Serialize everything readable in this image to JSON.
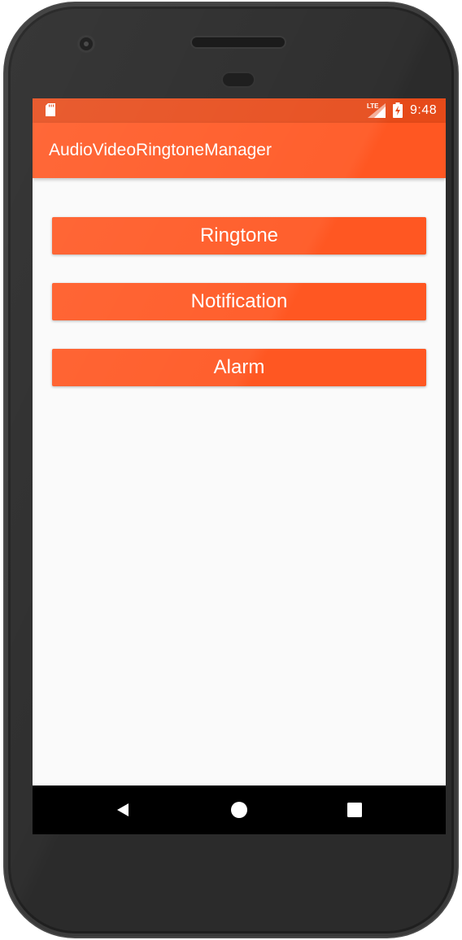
{
  "status_bar": {
    "time": "9:48",
    "network_label": "LTE",
    "icons": [
      "sd-card-icon",
      "signal-icon",
      "battery-charging-icon"
    ]
  },
  "app_bar": {
    "title": "AudioVideoRingtoneManager"
  },
  "buttons": {
    "ringtone": "Ringtone",
    "notification": "Notification",
    "alarm": "Alarm"
  },
  "nav_bar": {
    "icons": [
      "back-icon",
      "home-icon",
      "recents-icon"
    ]
  },
  "colors": {
    "primary": "#ff5722",
    "primary_dark": "#e64a19",
    "background": "#fafafa",
    "nav_bar": "#000000",
    "text_on_primary": "#ffffff"
  }
}
